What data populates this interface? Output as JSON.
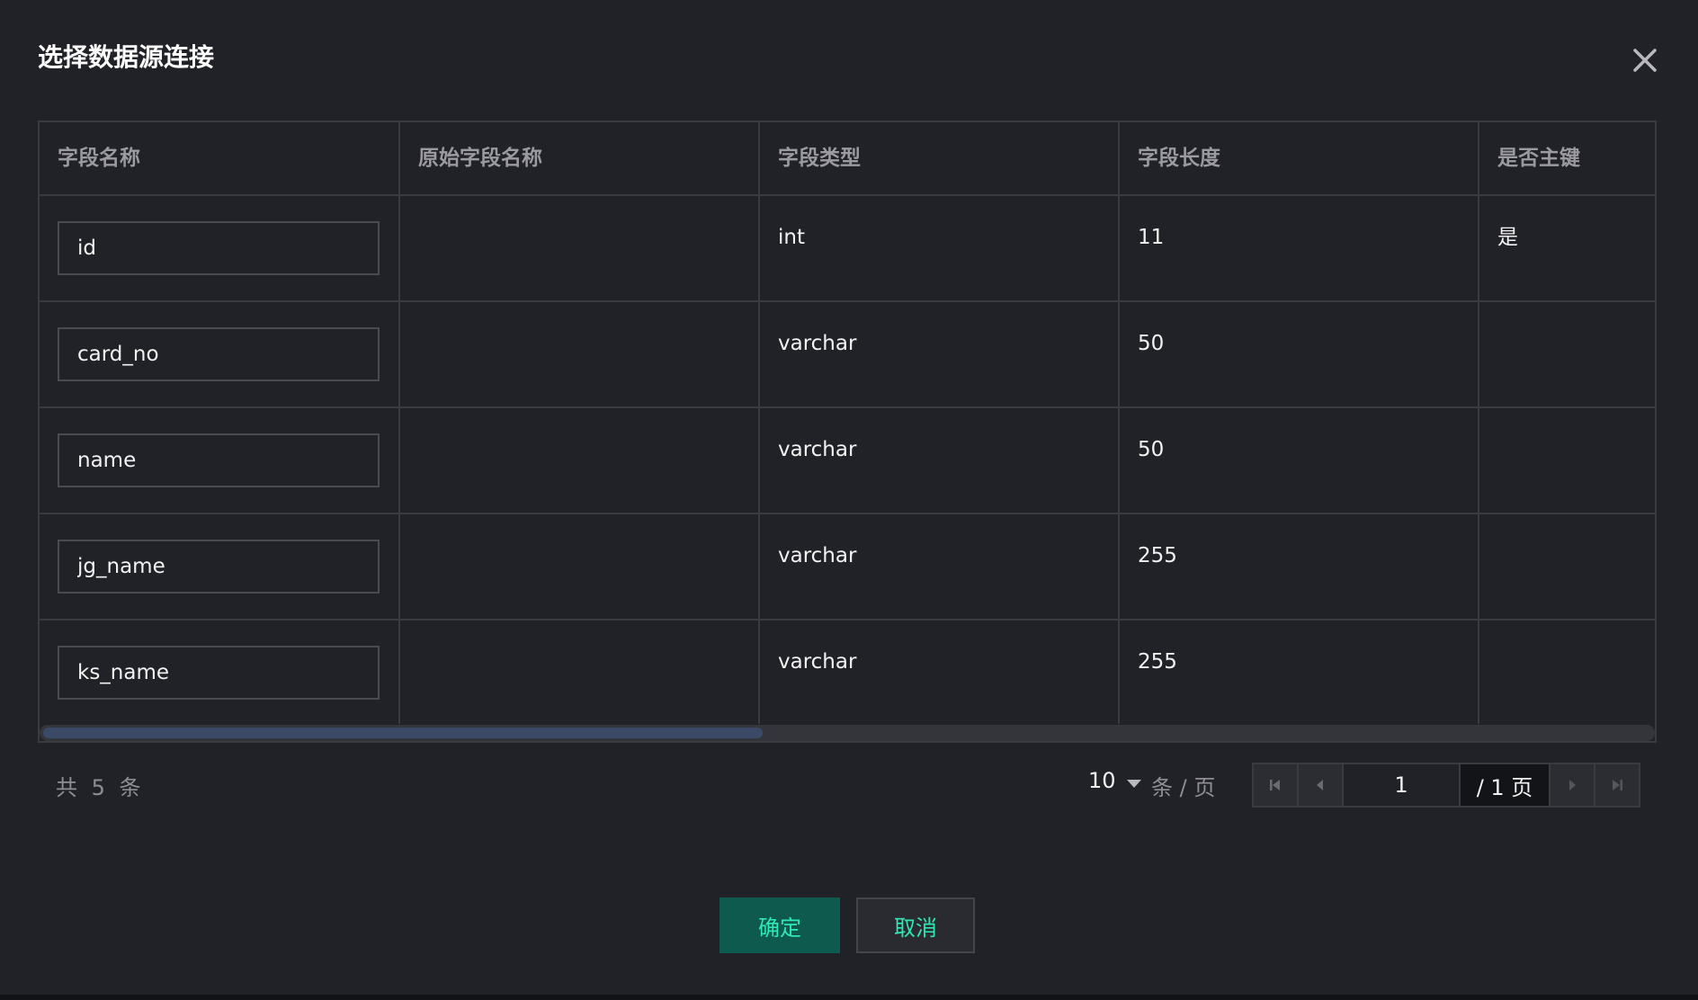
{
  "dialog": {
    "title": "选择数据源连接"
  },
  "table": {
    "headers": [
      "字段名称",
      "原始字段名称",
      "字段类型",
      "字段长度",
      "是否主键"
    ],
    "rows": [
      {
        "field_name": "id",
        "original_name": "",
        "type": "int",
        "length": "11",
        "primary_key": "是"
      },
      {
        "field_name": "card_no",
        "original_name": "",
        "type": "varchar",
        "length": "50",
        "primary_key": ""
      },
      {
        "field_name": "name",
        "original_name": "",
        "type": "varchar",
        "length": "50",
        "primary_key": ""
      },
      {
        "field_name": "jg_name",
        "original_name": "",
        "type": "varchar",
        "length": "255",
        "primary_key": ""
      },
      {
        "field_name": "ks_name",
        "original_name": "",
        "type": "varchar",
        "length": "255",
        "primary_key": ""
      }
    ]
  },
  "pagination": {
    "total_label": "共 5 条",
    "page_size": "10",
    "per_page_label": "条 / 页",
    "current_page": "1",
    "total_pages_label": "/ 1 页"
  },
  "footer": {
    "ok_label": "确定",
    "cancel_label": "取消"
  },
  "colors": {
    "background": "#212227",
    "accent": "#2ee8b5",
    "primary_button": "#0f5a4e",
    "border": "#3a3b41"
  },
  "icons": {
    "close": "close-icon",
    "first": "first-page-icon",
    "prev": "prev-page-icon",
    "next": "next-page-icon",
    "last": "last-page-icon",
    "dropdown": "caret-down-icon"
  }
}
